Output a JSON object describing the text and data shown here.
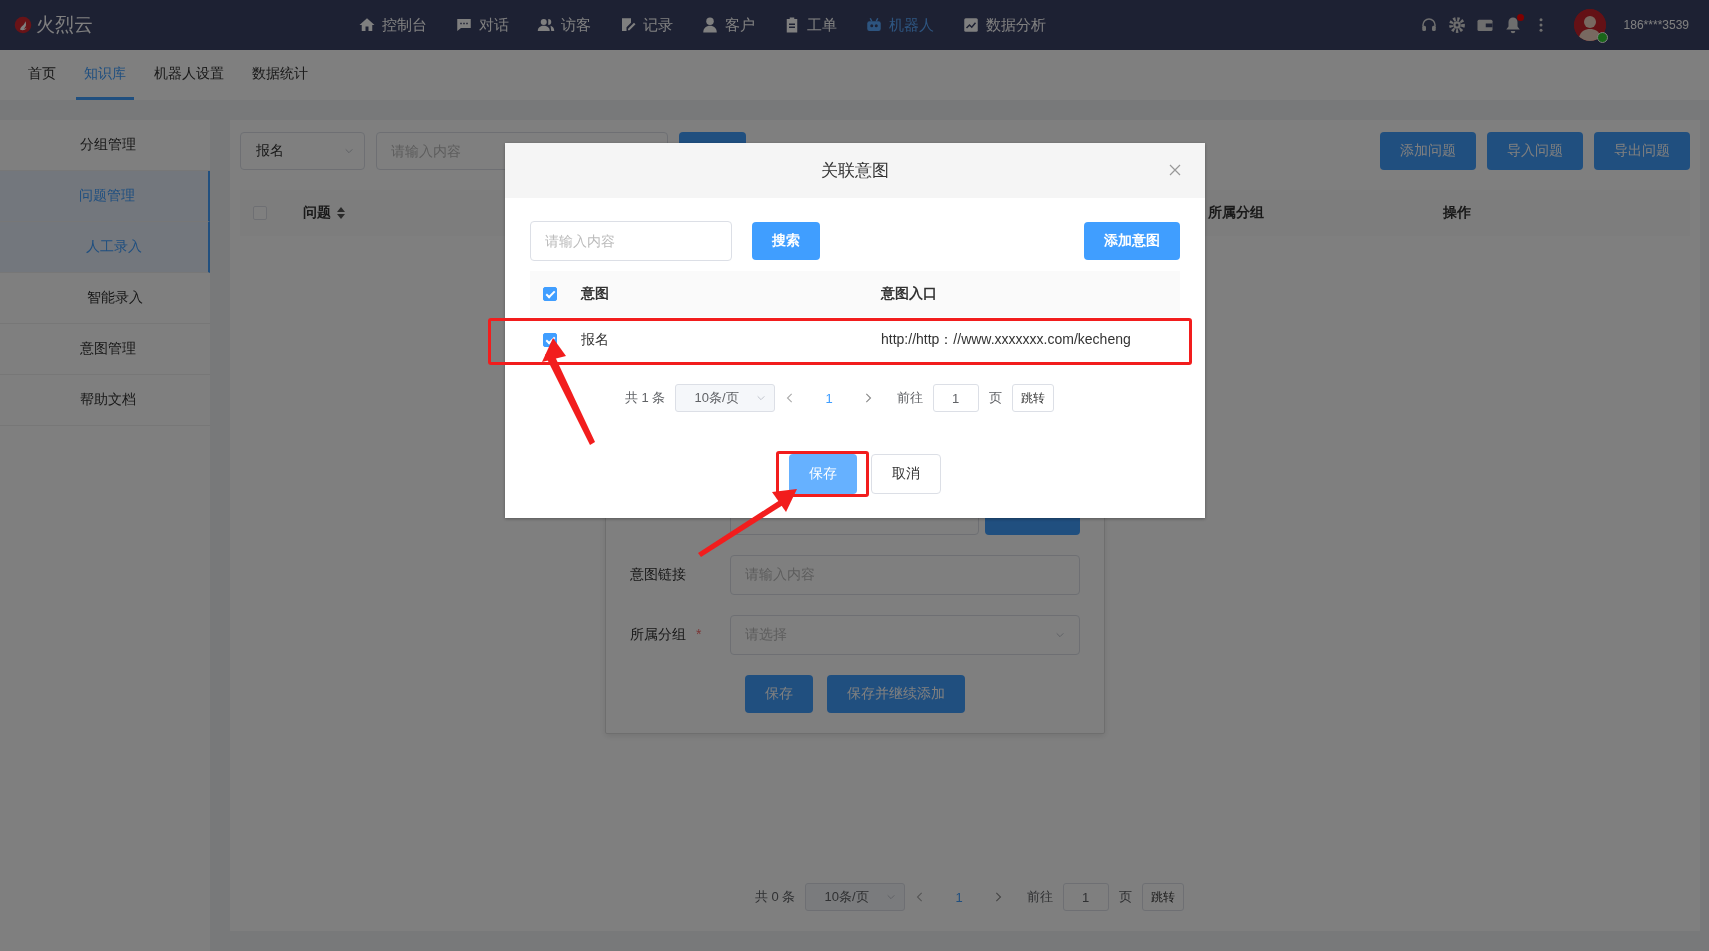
{
  "top_nav": {
    "logo": "火烈云",
    "items": [
      {
        "label": "控制台",
        "selected": false
      },
      {
        "label": "对话",
        "selected": false
      },
      {
        "label": "访客",
        "selected": false
      },
      {
        "label": "记录",
        "selected": false
      },
      {
        "label": "客户",
        "selected": false
      },
      {
        "label": "工单",
        "selected": false
      },
      {
        "label": "机器人",
        "selected": true
      },
      {
        "label": "数据分析",
        "selected": false
      }
    ],
    "notification_dot": true,
    "user": "186****3539",
    "online": true
  },
  "sub_nav": [
    {
      "label": "首页",
      "selected": false
    },
    {
      "label": "知识库",
      "selected": true
    },
    {
      "label": "机器人设置",
      "selected": false
    },
    {
      "label": "数据统计",
      "selected": false
    }
  ],
  "sidebar": [
    {
      "label": "分组管理",
      "selected": false
    },
    {
      "label": "问题管理",
      "selected": true,
      "children": [
        {
          "label": "人工录入",
          "selected": true
        },
        {
          "label": "智能录入",
          "selected": false
        }
      ]
    },
    {
      "label": "意图管理",
      "selected": false
    },
    {
      "label": "帮助文档",
      "selected": false
    }
  ],
  "toolbar": {
    "select": "报名",
    "search_placeholder": "请输入内容",
    "buttons": [
      "添加问题",
      "导入问题",
      "导出问题"
    ]
  },
  "table": {
    "checked": false,
    "columns": [
      {
        "label": "问题",
        "sortable": true
      },
      {
        "label": "所属分组",
        "sortable": false
      },
      {
        "label": "操作",
        "sortable": false
      }
    ]
  },
  "form": {
    "fields": [
      {
        "label": "意图链接",
        "kind": "input",
        "placeholder": "请输入内容"
      },
      {
        "label": "所属分组",
        "kind": "select",
        "placeholder": "请选择",
        "required_mark": "*"
      }
    ],
    "buttons": [
      "保存",
      "保存并继续添加"
    ]
  },
  "pagination": {
    "total": "共 0 条",
    "page_size": "10条/页",
    "page": "1",
    "goto": "前往",
    "goto_value": "1",
    "unit": "页",
    "jump": "跳转"
  },
  "dialog": {
    "title": "关联意图",
    "search_placeholder": "请输入内容",
    "search_button": "搜索",
    "add_button": "添加意图",
    "header_checked": true,
    "columns": [
      "意图",
      "意图入口"
    ],
    "rows": [
      {
        "intent": "报名",
        "url": "http://http：//www.xxxxxxx.com/kecheng",
        "checked": true,
        "highlighted": true
      }
    ],
    "pagination": {
      "total": "共 1 条",
      "page_size": "10条/页",
      "page": "1",
      "goto": "前往",
      "goto_value": "1",
      "unit": "页",
      "jump": "跳转"
    },
    "buttons": [
      {
        "label": "保存",
        "kind": "primary",
        "highlighted": true
      },
      {
        "label": "取消",
        "kind": "default",
        "highlighted": false
      }
    ]
  }
}
